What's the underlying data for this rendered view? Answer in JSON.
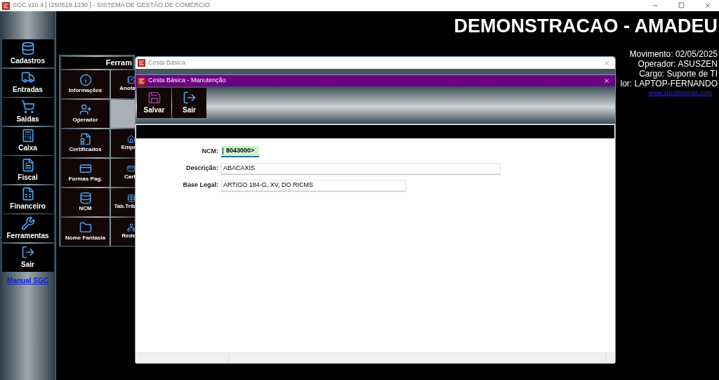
{
  "app_titlebar": {
    "title": "SGC v10.4 [ r250519.1230 ] - SISTEMA DE GESTÃO DE COMÉRCIO"
  },
  "sidebar": {
    "items": [
      {
        "label": "Cadastros"
      },
      {
        "label": "Entradas"
      },
      {
        "label": "Saidas"
      },
      {
        "label": "Caixa"
      },
      {
        "label": "Fiscal"
      },
      {
        "label": "Financeiro"
      },
      {
        "label": "Ferramentas"
      },
      {
        "label": "Sair"
      }
    ],
    "link": "Manual SGC"
  },
  "header": {
    "company": "DEMONSTRACAO - AMADEU",
    "info": [
      "Movimento: 02/05/2025",
      "Operador: ASUSZEN",
      "Cargo: Suporte de TI",
      "lor: LAPTOP-FERNANDO"
    ],
    "link": "www.sgcsistemas.com"
  },
  "tools_panel": {
    "title": "Ferram",
    "items": [
      {
        "label": "Informações"
      },
      {
        "label": "Anota"
      },
      {
        "label": "Operador"
      },
      {
        "kind": "empty"
      },
      {
        "label": "Certificados"
      },
      {
        "label": "Empr"
      },
      {
        "label": "Formas Pag."
      },
      {
        "label": "Cart"
      },
      {
        "label": "NCM"
      },
      {
        "label": "Tab.Trib"
      },
      {
        "label": "Nome Fantasia"
      },
      {
        "label": "Rede"
      }
    ]
  },
  "back_window": {
    "title": "Cesta Básica"
  },
  "form_window": {
    "title": "Cesta Básica - Manutenção",
    "toolbar": [
      {
        "label": "Salvar"
      },
      {
        "label": "Sair"
      }
    ],
    "fields": [
      {
        "label": "NCM:",
        "value": "8043000>",
        "focused": true
      },
      {
        "label": "Descrição:",
        "value": "ABACAXIS",
        "focused": false
      },
      {
        "label": "Base Legal:",
        "value": "ARTIGO 184-G, XV, DO RICMS",
        "focused": false
      }
    ]
  }
}
